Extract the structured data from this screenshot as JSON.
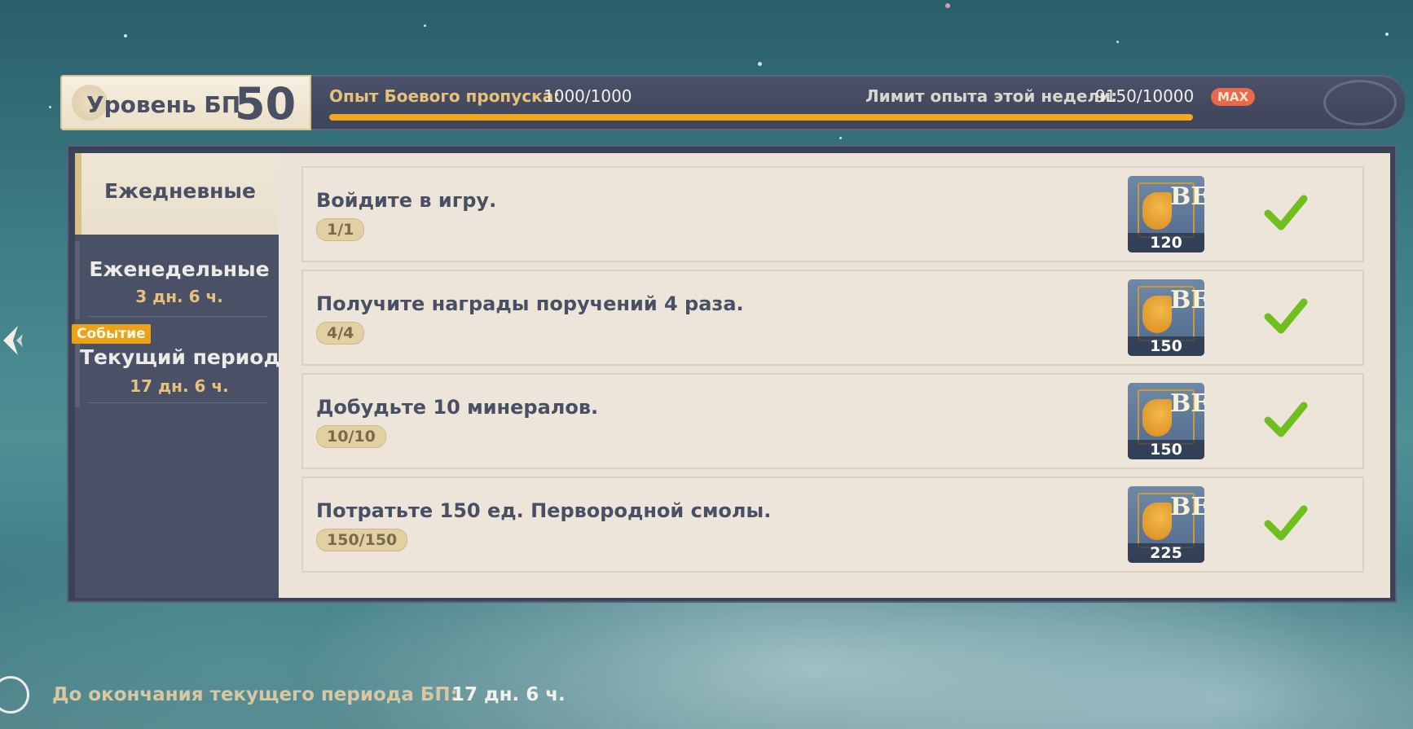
{
  "header": {
    "level_label": "Уровень БП",
    "level_value": "50",
    "exp_label": "Опыт Боевого пропуска:",
    "exp_value": "1000/1000",
    "exp_progress_fraction": 1.0,
    "weekly_limit_label": "Лимит опыта этой недели:",
    "weekly_limit_value": "9150/10000",
    "max_badge": "MAX"
  },
  "sidebar": {
    "tabs": [
      {
        "label": "Ежедневные",
        "selected": true
      },
      {
        "label": "Еженедельные",
        "time": "3 дн. 6 ч.",
        "selected": false
      },
      {
        "label": "Текущий период",
        "time": "17 дн. 6 ч.",
        "badge": "Событие",
        "selected": false
      }
    ]
  },
  "tasks": [
    {
      "title": "Войдите в игру.",
      "progress": "1/1",
      "reward": "120",
      "completed": true
    },
    {
      "title": "Получите награды поручений 4 раза.",
      "progress": "4/4",
      "reward": "150",
      "completed": true
    },
    {
      "title": "Добудьте 10 минералов.",
      "progress": "10/10",
      "reward": "150",
      "completed": true
    },
    {
      "title": "Потратьте 150 ед. Первородной смолы.",
      "progress": "150/150",
      "reward": "225",
      "completed": true
    }
  ],
  "reward_icon_letters": "ВЕ",
  "footer": {
    "label": "До окончания текущего периода БП:",
    "value": "17 дн. 6 ч."
  },
  "colors": {
    "accent_gold": "#e7c07a",
    "progress_fill": "#f0a820",
    "max_badge": "#e66a4c",
    "check_green": "#6fbf1e"
  },
  "icons": [
    "battle-pass-emblem-icon",
    "back-arrow-icon",
    "checkmark-icon",
    "battle-pass-exp-icon",
    "compass-icon"
  ]
}
